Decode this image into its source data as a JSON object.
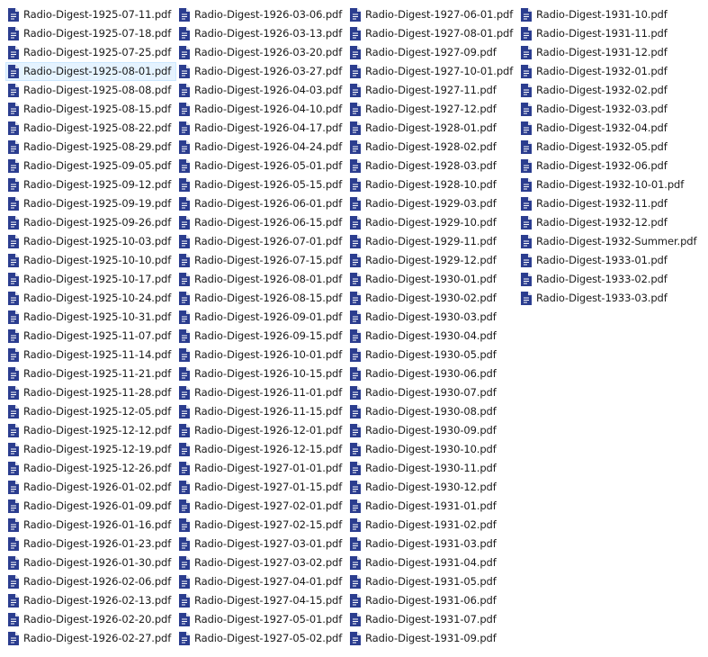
{
  "colors": {
    "icon_fill": "#2b3d8f",
    "icon_fold": "#ffffff",
    "hover_background": "#e5f3ff",
    "hover_border": "#cce8ff",
    "text": "#1a1a1a"
  },
  "icon_name": "pdf-file-icon",
  "hovered_file": "Radio-Digest-1925-08-01.pdf",
  "columns": [
    {
      "files": [
        "Radio-Digest-1925-07-11.pdf",
        "Radio-Digest-1925-07-18.pdf",
        "Radio-Digest-1925-07-25.pdf",
        "Radio-Digest-1925-08-01.pdf",
        "Radio-Digest-1925-08-08.pdf",
        "Radio-Digest-1925-08-15.pdf",
        "Radio-Digest-1925-08-22.pdf",
        "Radio-Digest-1925-08-29.pdf",
        "Radio-Digest-1925-09-05.pdf",
        "Radio-Digest-1925-09-12.pdf",
        "Radio-Digest-1925-09-19.pdf",
        "Radio-Digest-1925-09-26.pdf",
        "Radio-Digest-1925-10-03.pdf",
        "Radio-Digest-1925-10-10.pdf",
        "Radio-Digest-1925-10-17.pdf",
        "Radio-Digest-1925-10-24.pdf",
        "Radio-Digest-1925-10-31.pdf",
        "Radio-Digest-1925-11-07.pdf",
        "Radio-Digest-1925-11-14.pdf",
        "Radio-Digest-1925-11-21.pdf",
        "Radio-Digest-1925-11-28.pdf",
        "Radio-Digest-1925-12-05.pdf",
        "Radio-Digest-1925-12-12.pdf",
        "Radio-Digest-1925-12-19.pdf",
        "Radio-Digest-1925-12-26.pdf",
        "Radio-Digest-1926-01-02.pdf",
        "Radio-Digest-1926-01-09.pdf",
        "Radio-Digest-1926-01-16.pdf",
        "Radio-Digest-1926-01-23.pdf",
        "Radio-Digest-1926-01-30.pdf",
        "Radio-Digest-1926-02-06.pdf",
        "Radio-Digest-1926-02-13.pdf",
        "Radio-Digest-1926-02-20.pdf",
        "Radio-Digest-1926-02-27.pdf"
      ]
    },
    {
      "files": [
        "Radio-Digest-1926-03-06.pdf",
        "Radio-Digest-1926-03-13.pdf",
        "Radio-Digest-1926-03-20.pdf",
        "Radio-Digest-1926-03-27.pdf",
        "Radio-Digest-1926-04-03.pdf",
        "Radio-Digest-1926-04-10.pdf",
        "Radio-Digest-1926-04-17.pdf",
        "Radio-Digest-1926-04-24.pdf",
        "Radio-Digest-1926-05-01.pdf",
        "Radio-Digest-1926-05-15.pdf",
        "Radio-Digest-1926-06-01.pdf",
        "Radio-Digest-1926-06-15.pdf",
        "Radio-Digest-1926-07-01.pdf",
        "Radio-Digest-1926-07-15.pdf",
        "Radio-Digest-1926-08-01.pdf",
        "Radio-Digest-1926-08-15.pdf",
        "Radio-Digest-1926-09-01.pdf",
        "Radio-Digest-1926-09-15.pdf",
        "Radio-Digest-1926-10-01.pdf",
        "Radio-Digest-1926-10-15.pdf",
        "Radio-Digest-1926-11-01.pdf",
        "Radio-Digest-1926-11-15.pdf",
        "Radio-Digest-1926-12-01.pdf",
        "Radio-Digest-1926-12-15.pdf",
        "Radio-Digest-1927-01-01.pdf",
        "Radio-Digest-1927-01-15.pdf",
        "Radio-Digest-1927-02-01.pdf",
        "Radio-Digest-1927-02-15.pdf",
        "Radio-Digest-1927-03-01.pdf",
        "Radio-Digest-1927-03-02.pdf",
        "Radio-Digest-1927-04-01.pdf",
        "Radio-Digest-1927-04-15.pdf",
        "Radio-Digest-1927-05-01.pdf",
        "Radio-Digest-1927-05-02.pdf"
      ]
    },
    {
      "files": [
        "Radio-Digest-1927-06-01.pdf",
        "Radio-Digest-1927-08-01.pdf",
        "Radio-Digest-1927-09.pdf",
        "Radio-Digest-1927-10-01.pdf",
        "Radio-Digest-1927-11.pdf",
        "Radio-Digest-1927-12.pdf",
        "Radio-Digest-1928-01.pdf",
        "Radio-Digest-1928-02.pdf",
        "Radio-Digest-1928-03.pdf",
        "Radio-Digest-1928-10.pdf",
        "Radio-Digest-1929-03.pdf",
        "Radio-Digest-1929-10.pdf",
        "Radio-Digest-1929-11.pdf",
        "Radio-Digest-1929-12.pdf",
        "Radio-Digest-1930-01.pdf",
        "Radio-Digest-1930-02.pdf",
        "Radio-Digest-1930-03.pdf",
        "Radio-Digest-1930-04.pdf",
        "Radio-Digest-1930-05.pdf",
        "Radio-Digest-1930-06.pdf",
        "Radio-Digest-1930-07.pdf",
        "Radio-Digest-1930-08.pdf",
        "Radio-Digest-1930-09.pdf",
        "Radio-Digest-1930-10.pdf",
        "Radio-Digest-1930-11.pdf",
        "Radio-Digest-1930-12.pdf",
        "Radio-Digest-1931-01.pdf",
        "Radio-Digest-1931-02.pdf",
        "Radio-Digest-1931-03.pdf",
        "Radio-Digest-1931-04.pdf",
        "Radio-Digest-1931-05.pdf",
        "Radio-Digest-1931-06.pdf",
        "Radio-Digest-1931-07.pdf",
        "Radio-Digest-1931-09.pdf"
      ]
    },
    {
      "files": [
        "Radio-Digest-1931-10.pdf",
        "Radio-Digest-1931-11.pdf",
        "Radio-Digest-1931-12.pdf",
        "Radio-Digest-1932-01.pdf",
        "Radio-Digest-1932-02.pdf",
        "Radio-Digest-1932-03.pdf",
        "Radio-Digest-1932-04.pdf",
        "Radio-Digest-1932-05.pdf",
        "Radio-Digest-1932-06.pdf",
        "Radio-Digest-1932-10-01.pdf",
        "Radio-Digest-1932-11.pdf",
        "Radio-Digest-1932-12.pdf",
        "Radio-Digest-1932-Summer.pdf",
        "Radio-Digest-1933-01.pdf",
        "Radio-Digest-1933-02.pdf",
        "Radio-Digest-1933-03.pdf"
      ]
    }
  ]
}
